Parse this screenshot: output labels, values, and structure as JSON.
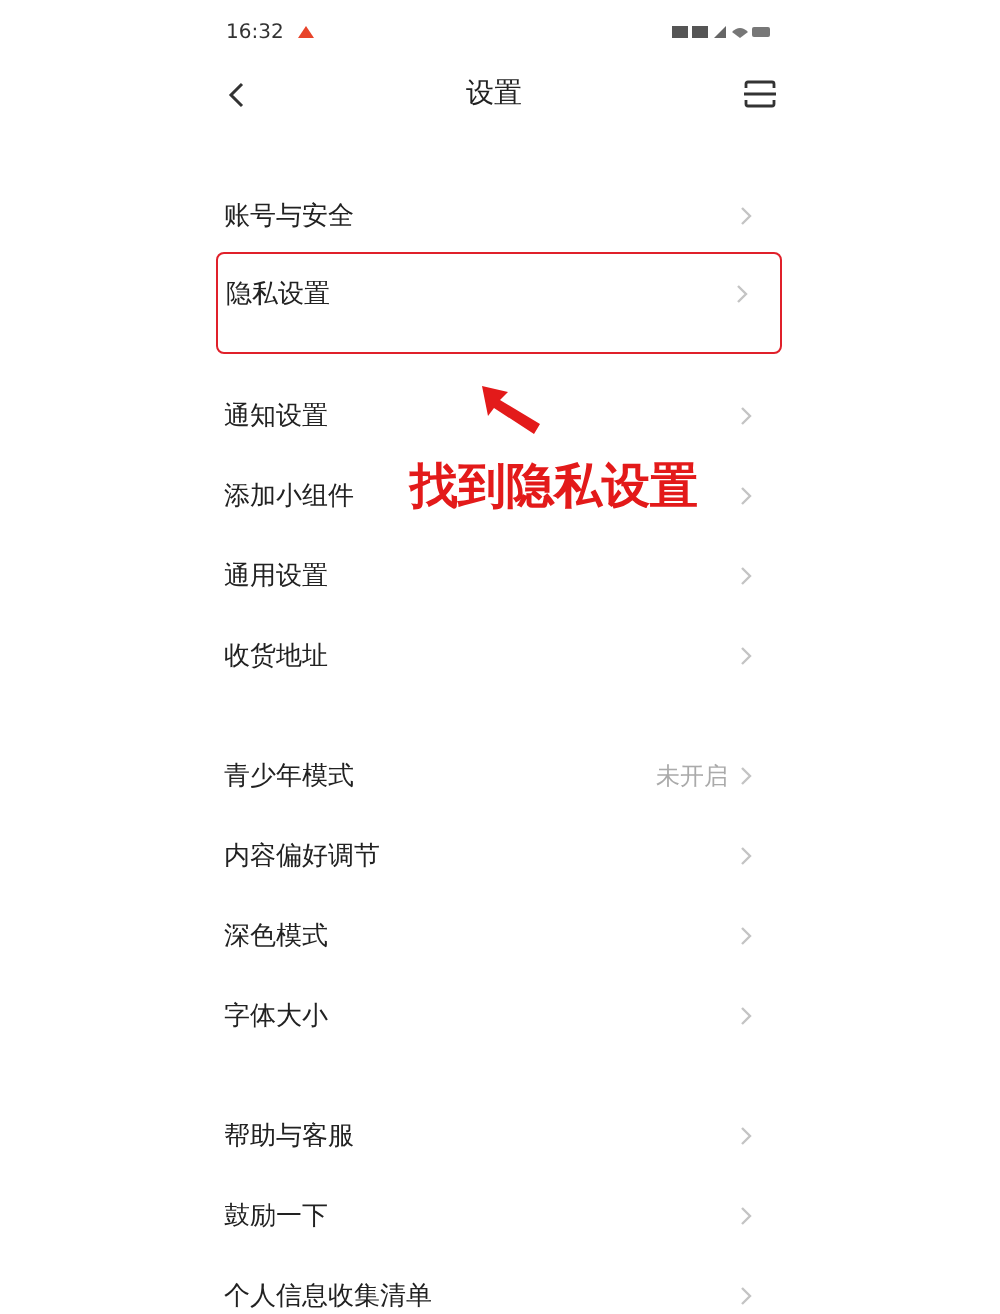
{
  "status_bar": {
    "time": "16:32"
  },
  "header": {
    "title": "设置"
  },
  "groups": [
    {
      "items": [
        {
          "label": "账号与安全",
          "highlighted": false
        },
        {
          "label": "隐私设置",
          "highlighted": true
        }
      ]
    },
    {
      "items": [
        {
          "label": "通知设置",
          "highlighted": false
        },
        {
          "label": "添加小组件",
          "highlighted": false
        },
        {
          "label": "通用设置",
          "highlighted": false
        },
        {
          "label": "收货地址",
          "highlighted": false
        }
      ]
    },
    {
      "items": [
        {
          "label": "青少年模式",
          "value": "未开启",
          "highlighted": false
        },
        {
          "label": "内容偏好调节",
          "highlighted": false
        },
        {
          "label": "深色模式",
          "highlighted": false
        },
        {
          "label": "字体大小",
          "highlighted": false
        }
      ]
    },
    {
      "items": [
        {
          "label": "帮助与客服",
          "highlighted": false
        },
        {
          "label": "鼓励一下",
          "highlighted": false
        },
        {
          "label": "个人信息收集清单",
          "highlighted": false
        }
      ]
    }
  ],
  "annotation": {
    "text": "找到隐私设置"
  }
}
